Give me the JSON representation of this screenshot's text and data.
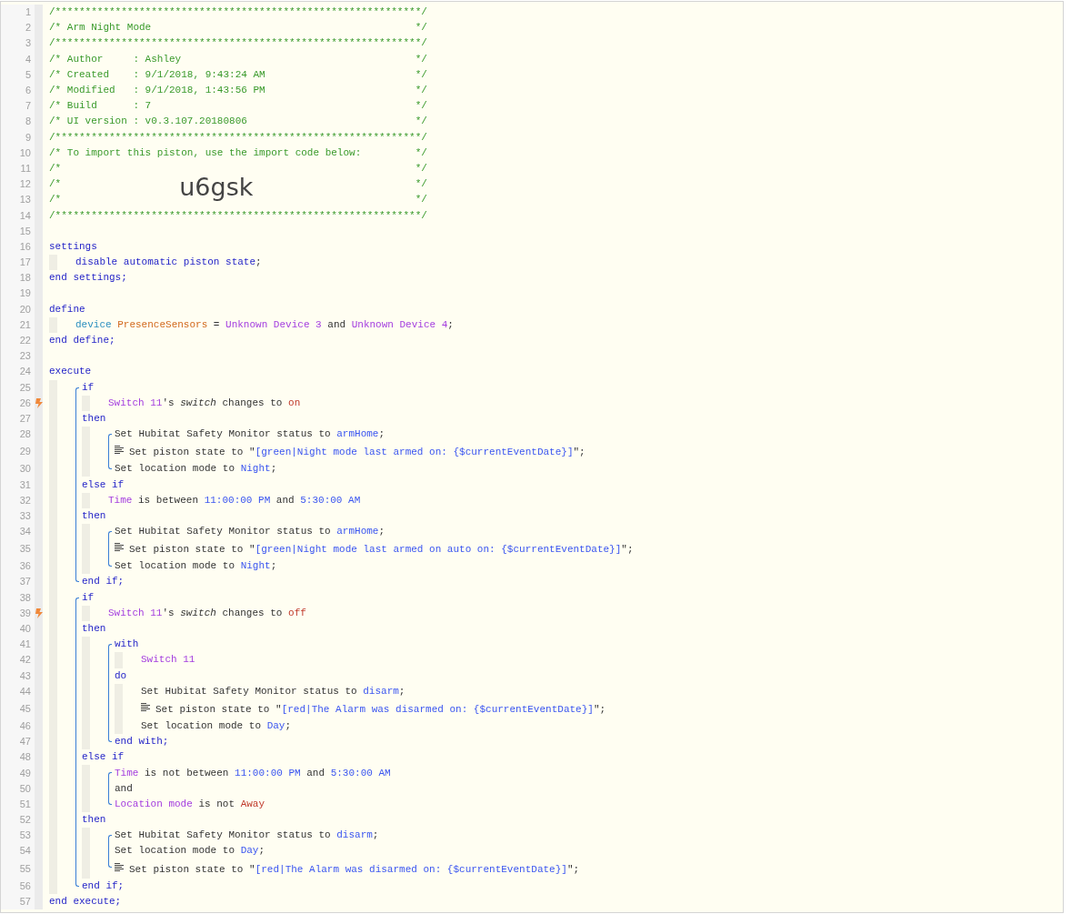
{
  "editor": {
    "lines": [
      {
        "kind": "comment",
        "number": "1",
        "trigger": false,
        "text": "/*************************************************************/"
      },
      {
        "kind": "comment",
        "number": "2",
        "trigger": false,
        "text": "/* Arm Night Mode",
        "close": "*/"
      },
      {
        "kind": "comment",
        "number": "3",
        "trigger": false,
        "text": "/*************************************************************/"
      },
      {
        "kind": "comment",
        "number": "4",
        "trigger": false,
        "text": "/* Author     : Ashley",
        "close": "*/"
      },
      {
        "kind": "comment",
        "number": "5",
        "trigger": false,
        "text": "/* Created    : 9/1/2018, 9:43:24 AM",
        "close": "*/"
      },
      {
        "kind": "comment",
        "number": "6",
        "trigger": false,
        "text": "/* Modified   : 9/1/2018, 1:43:56 PM",
        "close": "*/"
      },
      {
        "kind": "comment",
        "number": "7",
        "trigger": false,
        "text": "/* Build      : 7",
        "close": "*/"
      },
      {
        "kind": "comment",
        "number": "8",
        "trigger": false,
        "text": "/* UI version : v0.3.107.20180806",
        "close": "*/"
      },
      {
        "kind": "comment",
        "number": "9",
        "trigger": false,
        "text": "/*************************************************************/"
      },
      {
        "kind": "comment",
        "number": "10",
        "trigger": false,
        "text": "/* To import this piston, use the import code below:",
        "close": "*/"
      },
      {
        "kind": "comment",
        "number": "11",
        "trigger": false,
        "text": "/*",
        "close": "*/"
      },
      {
        "kind": "comment",
        "number": "12",
        "trigger": false,
        "text": "/*",
        "code": "u6gsk",
        "close": "*/"
      },
      {
        "kind": "comment",
        "number": "13",
        "trigger": false,
        "text": "/*",
        "close": "*/"
      },
      {
        "kind": "comment",
        "number": "14",
        "trigger": false,
        "text": "/*************************************************************/"
      },
      {
        "kind": "blank",
        "number": "15",
        "trigger": false
      },
      {
        "kind": "code",
        "number": "16",
        "trigger": false,
        "tokens": [
          {
            "kind": "keyword",
            "text": "settings"
          }
        ],
        "children": [
          {
            "kind": "code",
            "number": "17",
            "trigger": false,
            "tokens": [
              {
                "kind": "keyword",
                "text": "disable automatic piston state"
              },
              {
                "kind": "plain",
                "text": ";"
              }
            ]
          }
        ]
      },
      {
        "kind": "code",
        "number": "18",
        "trigger": false,
        "tokens": [
          {
            "kind": "keyword",
            "text": "end settings;"
          }
        ]
      },
      {
        "kind": "blank",
        "number": "19",
        "trigger": false
      },
      {
        "kind": "code",
        "number": "20",
        "trigger": false,
        "tokens": [
          {
            "kind": "keyword",
            "text": "define"
          }
        ],
        "children": [
          {
            "kind": "code",
            "number": "21",
            "trigger": false,
            "tokens": [
              {
                "kind": "type",
                "text": "device "
              },
              {
                "kind": "variable",
                "text": "PresenceSensors"
              },
              {
                "kind": "plain",
                "text": " = "
              },
              {
                "kind": "device",
                "text": "Unknown Device 3"
              },
              {
                "kind": "plain",
                "text": " and "
              },
              {
                "kind": "device",
                "text": "Unknown Device 4"
              },
              {
                "kind": "plain",
                "text": ";"
              }
            ]
          }
        ]
      },
      {
        "kind": "code",
        "number": "22",
        "trigger": false,
        "tokens": [
          {
            "kind": "keyword",
            "text": "end define;"
          }
        ]
      },
      {
        "kind": "blank",
        "number": "23",
        "trigger": false
      },
      {
        "kind": "code",
        "number": "24",
        "trigger": false,
        "tokens": [
          {
            "kind": "keyword",
            "text": "execute"
          }
        ],
        "children": [
          {
            "kind": "group",
            "items": [
              {
                "kind": "code",
                "number": "25",
                "trigger": false,
                "tokens": [
                  {
                    "kind": "keyword",
                    "text": "if"
                  }
                ],
                "children": [
                  {
                    "kind": "code",
                    "number": "26",
                    "trigger": true,
                    "tokens": [
                      {
                        "kind": "device",
                        "text": "Switch 11"
                      },
                      {
                        "kind": "plain",
                        "text": "'s "
                      },
                      {
                        "kind": "italic",
                        "text": "switch"
                      },
                      {
                        "kind": "plain",
                        "text": " changes to "
                      },
                      {
                        "kind": "literal",
                        "text": "on"
                      }
                    ]
                  }
                ]
              },
              {
                "kind": "code",
                "number": "27",
                "trigger": false,
                "tokens": [
                  {
                    "kind": "keyword",
                    "text": "then"
                  }
                ],
                "children": [
                  {
                    "kind": "group",
                    "items": [
                      {
                        "kind": "code",
                        "number": "28",
                        "trigger": false,
                        "tokens": [
                          {
                            "kind": "plain",
                            "text": "Set Hubitat Safety Monitor status to "
                          },
                          {
                            "kind": "value",
                            "text": "armHome"
                          },
                          {
                            "kind": "plain",
                            "text": ";"
                          }
                        ]
                      },
                      {
                        "kind": "note",
                        "number": "29",
                        "trigger": false,
                        "tokens": [
                          {
                            "kind": "plain",
                            "text": "Set piston state to \""
                          },
                          {
                            "kind": "value",
                            "text": "[green|Night mode last armed on: {$currentEventDate}]"
                          },
                          {
                            "kind": "plain",
                            "text": "\";"
                          }
                        ]
                      },
                      {
                        "kind": "code",
                        "number": "30",
                        "trigger": false,
                        "tokens": [
                          {
                            "kind": "plain",
                            "text": "Set location mode to "
                          },
                          {
                            "kind": "value",
                            "text": "Night"
                          },
                          {
                            "kind": "plain",
                            "text": ";"
                          }
                        ]
                      }
                    ]
                  }
                ]
              },
              {
                "kind": "code",
                "number": "31",
                "trigger": false,
                "tokens": [
                  {
                    "kind": "keyword",
                    "text": "else if"
                  }
                ],
                "children": [
                  {
                    "kind": "code",
                    "number": "32",
                    "trigger": false,
                    "tokens": [
                      {
                        "kind": "device",
                        "text": "Time"
                      },
                      {
                        "kind": "plain",
                        "text": " is between "
                      },
                      {
                        "kind": "value",
                        "text": "11:00:00 PM"
                      },
                      {
                        "kind": "plain",
                        "text": " and "
                      },
                      {
                        "kind": "value",
                        "text": "5:30:00 AM"
                      }
                    ]
                  }
                ]
              },
              {
                "kind": "code",
                "number": "33",
                "trigger": false,
                "tokens": [
                  {
                    "kind": "keyword",
                    "text": "then"
                  }
                ],
                "children": [
                  {
                    "kind": "group",
                    "items": [
                      {
                        "kind": "code",
                        "number": "34",
                        "trigger": false,
                        "tokens": [
                          {
                            "kind": "plain",
                            "text": "Set Hubitat Safety Monitor status to "
                          },
                          {
                            "kind": "value",
                            "text": "armHome"
                          },
                          {
                            "kind": "plain",
                            "text": ";"
                          }
                        ]
                      },
                      {
                        "kind": "note",
                        "number": "35",
                        "trigger": false,
                        "tokens": [
                          {
                            "kind": "plain",
                            "text": "Set piston state to \""
                          },
                          {
                            "kind": "value",
                            "text": "[green|Night mode last armed on auto on: {$currentEventDate}]"
                          },
                          {
                            "kind": "plain",
                            "text": "\";"
                          }
                        ]
                      },
                      {
                        "kind": "code",
                        "number": "36",
                        "trigger": false,
                        "tokens": [
                          {
                            "kind": "plain",
                            "text": "Set location mode to "
                          },
                          {
                            "kind": "value",
                            "text": "Night"
                          },
                          {
                            "kind": "plain",
                            "text": ";"
                          }
                        ]
                      }
                    ]
                  }
                ]
              },
              {
                "kind": "code",
                "number": "37",
                "trigger": false,
                "tokens": [
                  {
                    "kind": "keyword",
                    "text": "end if;"
                  }
                ]
              }
            ]
          },
          {
            "kind": "group",
            "items": [
              {
                "kind": "code",
                "number": "38",
                "trigger": false,
                "tokens": [
                  {
                    "kind": "keyword",
                    "text": "if"
                  }
                ],
                "children": [
                  {
                    "kind": "code",
                    "number": "39",
                    "trigger": true,
                    "tokens": [
                      {
                        "kind": "device",
                        "text": "Switch 11"
                      },
                      {
                        "kind": "plain",
                        "text": "'s "
                      },
                      {
                        "kind": "italic",
                        "text": "switch"
                      },
                      {
                        "kind": "plain",
                        "text": " changes to "
                      },
                      {
                        "kind": "literal",
                        "text": "off"
                      }
                    ]
                  }
                ]
              },
              {
                "kind": "code",
                "number": "40",
                "trigger": false,
                "tokens": [
                  {
                    "kind": "keyword",
                    "text": "then"
                  }
                ],
                "children": [
                  {
                    "kind": "group",
                    "items": [
                      {
                        "kind": "code",
                        "number": "41",
                        "trigger": false,
                        "tokens": [
                          {
                            "kind": "keyword",
                            "text": "with"
                          }
                        ],
                        "children": [
                          {
                            "kind": "code",
                            "number": "42",
                            "trigger": false,
                            "tokens": [
                              {
                                "kind": "device",
                                "text": "Switch 11"
                              }
                            ]
                          }
                        ]
                      },
                      {
                        "kind": "code",
                        "number": "43",
                        "trigger": false,
                        "tokens": [
                          {
                            "kind": "keyword",
                            "text": "do"
                          }
                        ],
                        "children": [
                          {
                            "kind": "code",
                            "number": "44",
                            "trigger": false,
                            "tokens": [
                              {
                                "kind": "plain",
                                "text": "Set Hubitat Safety Monitor status to "
                              },
                              {
                                "kind": "value",
                                "text": "disarm"
                              },
                              {
                                "kind": "plain",
                                "text": ";"
                              }
                            ]
                          },
                          {
                            "kind": "note",
                            "number": "45",
                            "trigger": false,
                            "tokens": [
                              {
                                "kind": "plain",
                                "text": "Set piston state to \""
                              },
                              {
                                "kind": "value",
                                "text": "[red|The Alarm was disarmed on: {$currentEventDate}]"
                              },
                              {
                                "kind": "plain",
                                "text": "\";"
                              }
                            ]
                          },
                          {
                            "kind": "code",
                            "number": "46",
                            "trigger": false,
                            "tokens": [
                              {
                                "kind": "plain",
                                "text": "Set location mode to "
                              },
                              {
                                "kind": "value",
                                "text": "Day"
                              },
                              {
                                "kind": "plain",
                                "text": ";"
                              }
                            ]
                          }
                        ]
                      },
                      {
                        "kind": "code",
                        "number": "47",
                        "trigger": false,
                        "tokens": [
                          {
                            "kind": "keyword",
                            "text": "end with;"
                          }
                        ]
                      }
                    ]
                  }
                ]
              },
              {
                "kind": "code",
                "number": "48",
                "trigger": false,
                "tokens": [
                  {
                    "kind": "keyword",
                    "text": "else if"
                  }
                ],
                "children": [
                  {
                    "kind": "group",
                    "items": [
                      {
                        "kind": "code",
                        "number": "49",
                        "trigger": false,
                        "tokens": [
                          {
                            "kind": "device",
                            "text": "Time"
                          },
                          {
                            "kind": "plain",
                            "text": " is not between "
                          },
                          {
                            "kind": "value",
                            "text": "11:00:00 PM"
                          },
                          {
                            "kind": "plain",
                            "text": " and "
                          },
                          {
                            "kind": "value",
                            "text": "5:30:00 AM"
                          }
                        ]
                      },
                      {
                        "kind": "code",
                        "number": "50",
                        "trigger": false,
                        "tokens": [
                          {
                            "kind": "plain",
                            "text": "and"
                          }
                        ]
                      },
                      {
                        "kind": "code",
                        "number": "51",
                        "trigger": false,
                        "tokens": [
                          {
                            "kind": "device",
                            "text": "Location mode"
                          },
                          {
                            "kind": "plain",
                            "text": " is not "
                          },
                          {
                            "kind": "literal",
                            "text": "Away"
                          }
                        ]
                      }
                    ]
                  }
                ]
              },
              {
                "kind": "code",
                "number": "52",
                "trigger": false,
                "tokens": [
                  {
                    "kind": "keyword",
                    "text": "then"
                  }
                ],
                "children": [
                  {
                    "kind": "group",
                    "items": [
                      {
                        "kind": "code",
                        "number": "53",
                        "trigger": false,
                        "tokens": [
                          {
                            "kind": "plain",
                            "text": "Set Hubitat Safety Monitor status to "
                          },
                          {
                            "kind": "value",
                            "text": "disarm"
                          },
                          {
                            "kind": "plain",
                            "text": ";"
                          }
                        ]
                      },
                      {
                        "kind": "code",
                        "number": "54",
                        "trigger": false,
                        "tokens": [
                          {
                            "kind": "plain",
                            "text": "Set location mode to "
                          },
                          {
                            "kind": "value",
                            "text": "Day"
                          },
                          {
                            "kind": "plain",
                            "text": ";"
                          }
                        ]
                      },
                      {
                        "kind": "note",
                        "number": "55",
                        "trigger": false,
                        "tokens": [
                          {
                            "kind": "plain",
                            "text": "Set piston state to \""
                          },
                          {
                            "kind": "value",
                            "text": "[red|The Alarm was disarmed on: {$currentEventDate}]"
                          },
                          {
                            "kind": "plain",
                            "text": "\";"
                          }
                        ]
                      }
                    ]
                  }
                ]
              },
              {
                "kind": "code",
                "number": "56",
                "trigger": false,
                "tokens": [
                  {
                    "kind": "keyword",
                    "text": "end if;"
                  }
                ]
              }
            ]
          }
        ]
      },
      {
        "kind": "code",
        "number": "57",
        "trigger": false,
        "tokens": [
          {
            "kind": "keyword",
            "text": "end execute;"
          }
        ]
      }
    ]
  }
}
